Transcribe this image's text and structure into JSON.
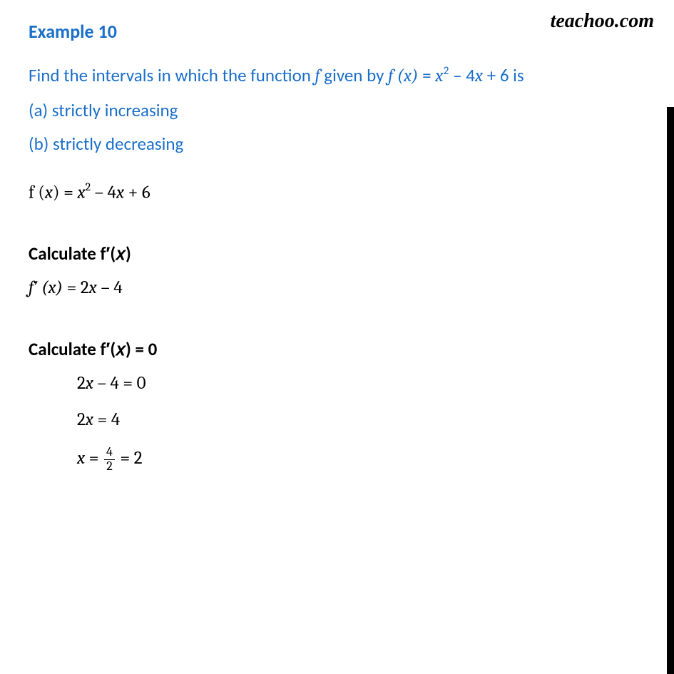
{
  "watermark": "teachoo.com",
  "title": "Example 10",
  "prompt": {
    "line1_pre": "Find the intervals in which the function ",
    "f": "f",
    "line1_mid": " given by ",
    "fx": "f (x)",
    "eq": " = ",
    "rhs_x2": "x",
    "rhs_sq": "2",
    "rhs_rest": " – 4",
    "rhs_x": "x",
    "rhs_end": " + 6 is",
    "part_a": "(a) strictly increasing",
    "part_b": "(b) strictly decreasing"
  },
  "body": {
    "fx_label": "f (",
    "x": "x",
    "close": ") = ",
    "x2": "x",
    "sq": "2",
    "rest": " – 4",
    "x_again": "x",
    "end": " + 6"
  },
  "section_calc_head": "Calculate f′(𝑥)",
  "deriv": {
    "lhs": "f′ (x)",
    "eq": "  =  ",
    "rhs_pre": "2",
    "rhs_x": "x",
    "rhs_post": " – 4"
  },
  "section_zero_head": "Calculate f′(𝑥) = 0",
  "steps": {
    "s1_pre": "2",
    "s1_x": "x",
    "s1_post": " – 4 = 0",
    "s2_pre": "2",
    "s2_x": "x",
    "s2_post": " = 4",
    "s3_x": "x",
    "s3_eq": " = ",
    "s3_num": "4",
    "s3_den": "2",
    "s3_eq2": " = 2"
  }
}
